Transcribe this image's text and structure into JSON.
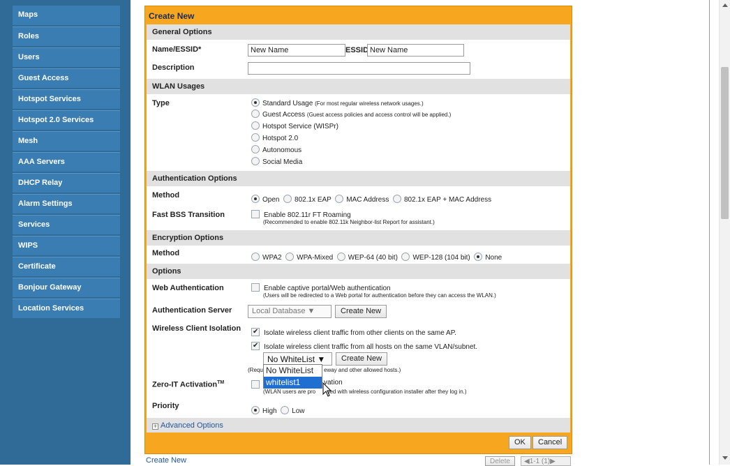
{
  "sidebar": {
    "items": [
      {
        "label": "Maps"
      },
      {
        "label": "Roles"
      },
      {
        "label": "Users"
      },
      {
        "label": "Guest Access"
      },
      {
        "label": "Hotspot Services"
      },
      {
        "label": "Hotspot 2.0 Services"
      },
      {
        "label": "Mesh"
      },
      {
        "label": "AAA Servers"
      },
      {
        "label": "DHCP Relay"
      },
      {
        "label": "Alarm Settings"
      },
      {
        "label": "Services"
      },
      {
        "label": "WIPS"
      },
      {
        "label": "Certificate"
      },
      {
        "label": "Bonjour Gateway"
      },
      {
        "label": "Location Services"
      }
    ]
  },
  "dialog": {
    "title": "Create New",
    "sections": {
      "general": "General Options",
      "wlan": "WLAN Usages",
      "auth": "Authentication Options",
      "encryption": "Encryption Options",
      "options": "Options"
    },
    "name_label": "Name/ESSID*",
    "name_value": "New Name",
    "essid_label": "ESSID",
    "essid_value": "New Name",
    "description_label": "Description",
    "description_value": "",
    "type_label": "Type",
    "type_options": [
      {
        "label": "Standard Usage",
        "note": "(For most regular wireless network usages.)",
        "checked": true
      },
      {
        "label": "Guest Access",
        "note": "(Guest access policies and access control will be applied.)",
        "checked": false
      },
      {
        "label": "Hotspot Service (WISPr)",
        "note": "",
        "checked": false
      },
      {
        "label": "Hotspot 2.0",
        "note": "",
        "checked": false
      },
      {
        "label": "Autonomous",
        "note": "",
        "checked": false
      },
      {
        "label": "Social Media",
        "note": "",
        "checked": false
      }
    ],
    "auth_method_label": "Method",
    "auth_methods": [
      {
        "label": "Open",
        "checked": true
      },
      {
        "label": "802.1x EAP",
        "checked": false
      },
      {
        "label": "MAC Address",
        "checked": false
      },
      {
        "label": "802.1x EAP + MAC Address",
        "checked": false
      }
    ],
    "fast_bss_label": "Fast BSS Transition",
    "fast_bss_text": "Enable 802.11r FT Roaming",
    "fast_bss_note": "(Recommended to enable 802.11k Neighbor-list Report for assistant.)",
    "enc_method_label": "Method",
    "enc_methods": [
      {
        "label": "WPA2",
        "checked": false
      },
      {
        "label": "WPA-Mixed",
        "checked": false
      },
      {
        "label": "WEP-64 (40 bit)",
        "checked": false
      },
      {
        "label": "WEP-128 (104 bit)",
        "checked": false
      },
      {
        "label": "None",
        "checked": true
      }
    ],
    "web_auth_label": "Web Authentication",
    "web_auth_text": "Enable captive portal/Web authentication",
    "web_auth_note": "(Users will be redirected to a Web portal for authentication before they can access the WLAN.)",
    "auth_server_label": "Authentication Server",
    "auth_server_value": "Local Database ▼",
    "create_new_label": "Create New",
    "isolation_label": "Wireless Client Isolation",
    "isolation_1": "Isolate wireless client traffic from other clients on the same AP.",
    "isolation_2": "Isolate wireless client traffic from all hosts on the same VLAN/subnet.",
    "whitelist_value": "No WhiteList ▼",
    "whitelist_note_a": "(Requ",
    "whitelist_note_b": "eway and other allowed hosts.)",
    "whitelist_options": [
      "No WhiteList",
      "whitelist1"
    ],
    "zero_it_label": "Zero-IT Activation",
    "zero_it_tm": "TM",
    "zero_it_text": "vation",
    "zero_it_note_a": "(WLAN users are pro",
    "zero_it_note_b": "ded with wireless configuration installer after they log in.)",
    "priority_label": "Priority",
    "priorities": [
      {
        "label": "High",
        "checked": true
      },
      {
        "label": "Low",
        "checked": false
      }
    ],
    "advanced_label": "Advanced Options",
    "ok_label": "OK",
    "cancel_label": "Cancel"
  },
  "footer": {
    "create_new_link": "Create New",
    "delete_label": "Delete",
    "pager": "1-1 (1)"
  }
}
